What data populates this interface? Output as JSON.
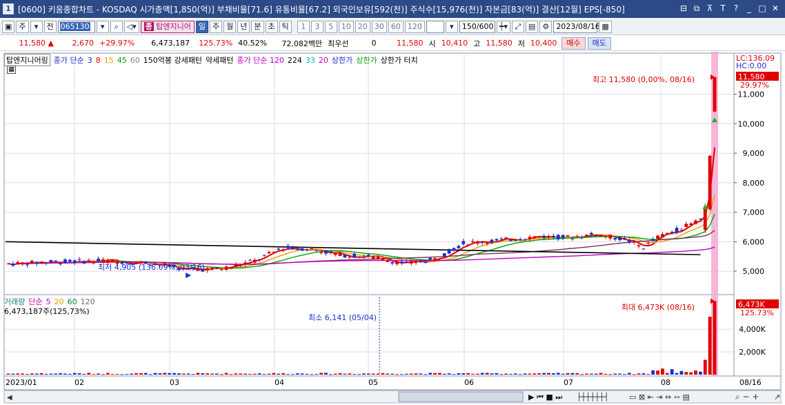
{
  "titlebar": {
    "number": "1",
    "title": "[0600] 키움종합차트 - KOSDAQ 시가총액[1,850(억)] 부채비율[71.6] 유통비율[67.2] 외국인보유[592(천)] 주식수[15,976(천)] 자본금[83(억)] 결산[12월] EPS[-850]"
  },
  "toolbar": {
    "type_select": "주",
    "prev_label": "전",
    "code": "065130",
    "target_label": "탑엔지니어",
    "period_tabs": [
      "일",
      "주",
      "월",
      "년",
      "분",
      "초",
      "틱"
    ],
    "selected_period": "일",
    "intervals": [
      "1",
      "3",
      "5",
      "10",
      "20",
      "30",
      "60",
      "120"
    ],
    "bar_count": "150/600",
    "date": "2023/08/16"
  },
  "quote": {
    "price": "11,580",
    "change": "2,670",
    "change_pct": "+29.97%",
    "volume": "6,473,187",
    "volume_ratio": "125.73%",
    "turnover_pct": "40.52%",
    "amount": "72,082백만",
    "preferred_label": "최우선",
    "preferred_value": "0",
    "last": "11,580",
    "open_label": "시",
    "open": "10,410",
    "high_label": "고",
    "high": "11,580",
    "low_label": "저",
    "low": "10,400",
    "buy_label": "매수",
    "sell_label": "매도"
  },
  "price_legend": {
    "name": "탑엔지니어링",
    "ma_label": "종가 단순",
    "ma_periods": [
      "3",
      "8",
      "15",
      "45",
      "60"
    ],
    "pattern1": "150억봉 강세패턴",
    "pattern2": "약세패턴",
    "ma2_label": "종가 단순 120",
    "ma2_values": [
      "224",
      "33",
      "20"
    ],
    "limit1": "상한가",
    "limit2": "상한가",
    "limit3": "상한가 터치"
  },
  "volume_legend": {
    "name": "거래량",
    "ma_label": "단순",
    "periods": [
      "5",
      "20",
      "60",
      "120"
    ],
    "current": "6,473,187주(125,73%)"
  },
  "annotations": {
    "high": "최고 11,580 (0,00%, 08/16)",
    "low": "최저 4,905 (136.09%, 03/16)",
    "vol_max": "최대 6,473K (08/16)",
    "vol_min": "최소 6,141 (05/04)"
  },
  "right_axis": {
    "lc": "LC:136.09",
    "hc": "HC:0.00",
    "price_tag": "11,580",
    "price_pct": "29.97%",
    "vol_tag": "6,473K",
    "vol_pct": "125.73%"
  },
  "colors": {
    "up": "#e00000",
    "down": "#1a2fd0",
    "highlight": "#f5a9d2",
    "titlebar": "#2c4a86"
  },
  "chart_data": {
    "type": "candlestick",
    "y_ticks": [
      "11,000",
      "10,000",
      "9,000",
      "8,000",
      "7,000",
      "6,000",
      "5,000"
    ],
    "y_values": [
      11000,
      10000,
      9000,
      8000,
      7000,
      6000,
      5000
    ],
    "ylim": [
      4300,
      12300
    ],
    "vol_ticks": [
      "4,000K",
      "2,000K"
    ],
    "vol_values": [
      4000,
      2000
    ],
    "vol_ylim": [
      0,
      6800
    ],
    "x_labels": [
      "2023/01",
      "02",
      "03",
      "04",
      "05",
      "06",
      "07",
      "08"
    ],
    "last_date_label": "08/16",
    "recent": [
      {
        "date": "08/14",
        "open": 6400,
        "high": 7300,
        "low": 6300,
        "close": 7100,
        "volume": 1300
      },
      {
        "date": "08/15",
        "open": 7100,
        "high": 8950,
        "low": 7050,
        "close": 8910,
        "volume": 5100
      },
      {
        "date": "08/16",
        "open": 10410,
        "high": 11580,
        "low": 10400,
        "close": 11580,
        "volume": 6473
      }
    ]
  }
}
